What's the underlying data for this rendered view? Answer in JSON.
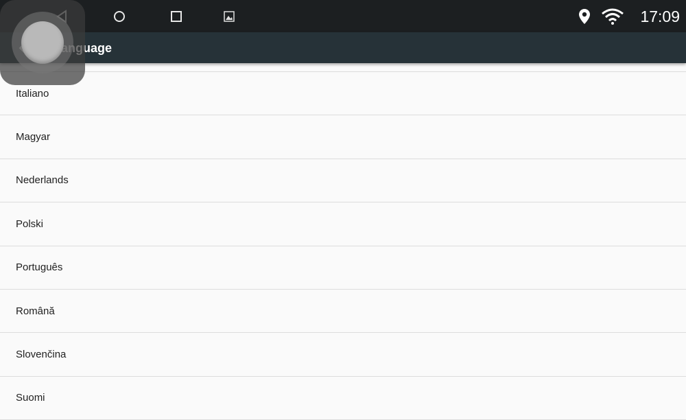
{
  "status_bar": {
    "icons": [
      "back-triangle-icon",
      "home-circle-icon",
      "recents-square-icon",
      "gallery-icon",
      "location-pin-icon",
      "wifi-icon"
    ],
    "time": "17:09"
  },
  "toolbar": {
    "title": "Language",
    "back_icon": "arrow-left-icon"
  },
  "languages": [
    "Italiano",
    "Magyar",
    "Nederlands",
    "Polski",
    "Português",
    "Română",
    "Slovenčina",
    "Suomi"
  ],
  "floating_button": {
    "icon": "assistive-touch-icon"
  },
  "colors": {
    "status_bar_bg": "#1c1f21",
    "toolbar_bg": "#263238",
    "list_bg": "#fafafa",
    "divider": "#dcdcdc"
  }
}
